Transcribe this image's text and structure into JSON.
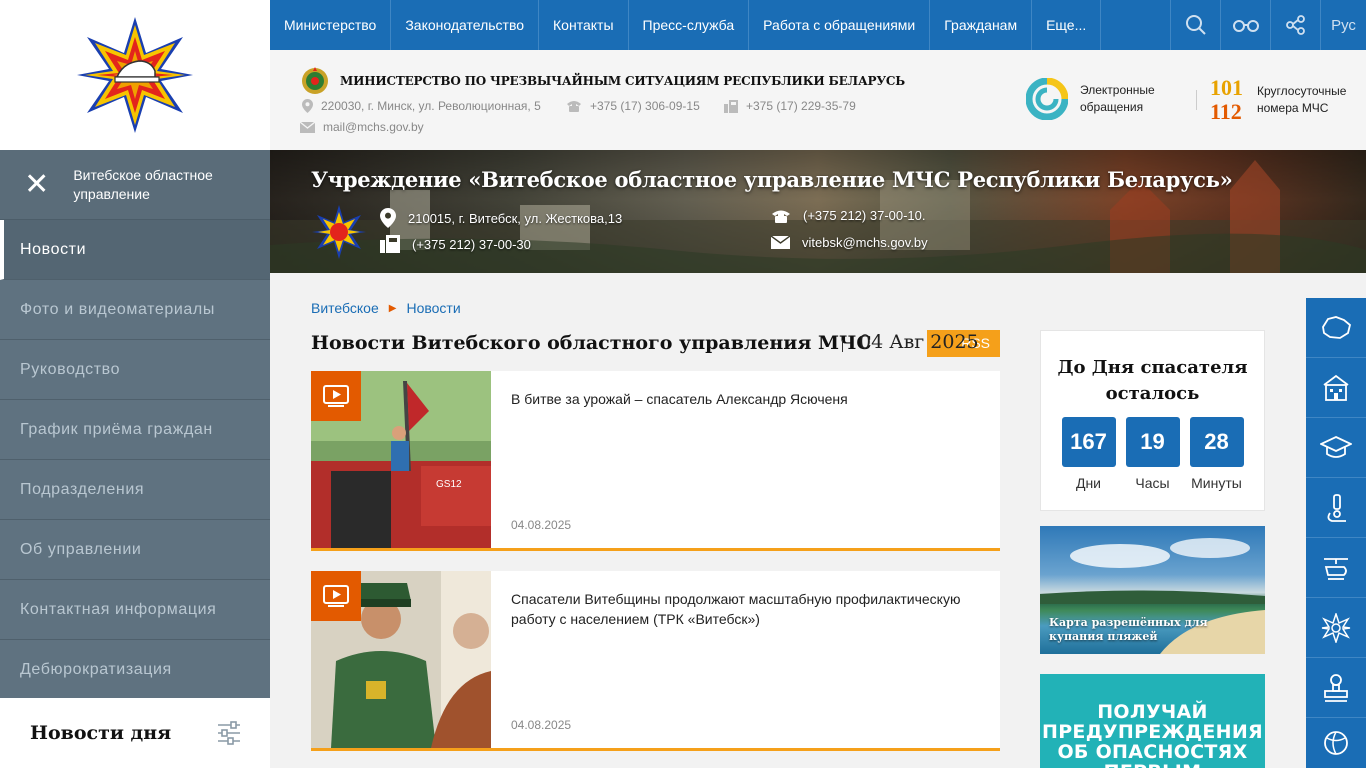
{
  "nav": {
    "items": [
      "Министерство",
      "Законодательство",
      "Контакты",
      "Пресс-служба",
      "Работа с обращениями",
      "Гражданам",
      "Еще..."
    ],
    "lang": "Рус",
    "icons": [
      "search-icon",
      "glasses-icon",
      "share-icon"
    ]
  },
  "ministry": {
    "name": "МИНИСТЕРСТВО ПО ЧРЕЗВЫЧАЙНЫМ СИТУАЦИЯМ РЕСПУБЛИКИ БЕЛАРУСЬ",
    "address": "220030, г. Минск, ул. Революционная, 5",
    "phone": "+375 (17) 306-09-15",
    "fax": "+375 (17) 229-35-79",
    "email": "mail@mchs.gov.by",
    "e_appeals": "Электронные обращения",
    "hotline_1": "101",
    "hotline_2": "112",
    "hotline_label": "Круглосуточные номера МЧС"
  },
  "sidebar": {
    "header": "Витебское областное управление",
    "items": [
      {
        "label": "Новости"
      },
      {
        "label": "Фото и видеоматериалы"
      },
      {
        "label": "Руководство"
      },
      {
        "label": "График приёма граждан"
      },
      {
        "label": "Подразделения"
      },
      {
        "label": "Об управлении"
      },
      {
        "label": "Контактная информация"
      },
      {
        "label": "Дебюрократизация"
      }
    ],
    "news_day": "Новости дня"
  },
  "banner": {
    "title": "Учреждение «Витебское областное управление МЧС Республики Беларусь»",
    "address": "210015, г. Витебск, ул. Жесткова,13",
    "fax": "(+375 212) 37-00-30",
    "phone": "(+375 212) 37-00-10.",
    "email": "vitebsk@mchs.gov.by"
  },
  "breadcrumb": [
    "Витебское",
    "Новости"
  ],
  "section": {
    "title": "Новости Витебского областного управления МЧС",
    "date": "04 Авг 2025",
    "rss": "RSS"
  },
  "news": [
    {
      "title": "В битве за урожай – спасатель Александр Ясюченя",
      "date": "04.08.2025"
    },
    {
      "title": "Спасатели Витебщины продолжают масштабную профилактическую работу с населением (ТРК «Витебск»)",
      "date": "04.08.2025"
    }
  ],
  "countdown": {
    "title": "До Дня спасателя осталось",
    "days": "167",
    "days_label": "Дни",
    "hours": "19",
    "hours_label": "Часы",
    "minutes": "28",
    "minutes_label": "Минуты"
  },
  "promos": {
    "beaches": "Карта разрешённых для купания пляжей",
    "alerts": "ПОЛУЧАЙ ПРЕДУПРЕЖДЕНИЯ ОБ ОПАСНОСТЯХ ПЕРВЫМ"
  },
  "colors": {
    "nav_blue": "#1a6db5",
    "accent_orange": "#e35a00",
    "rss_orange": "#f5a01a",
    "sidebar": "#5f7280"
  }
}
